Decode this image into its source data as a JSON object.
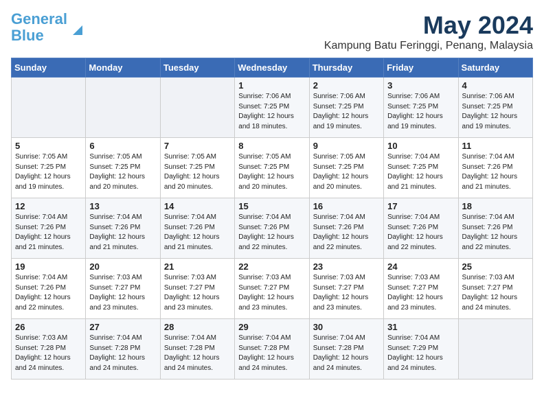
{
  "logo": {
    "line1": "General",
    "line2": "Blue"
  },
  "title": "May 2024",
  "subtitle": "Kampung Batu Feringgi, Penang, Malaysia",
  "weekdays": [
    "Sunday",
    "Monday",
    "Tuesday",
    "Wednesday",
    "Thursday",
    "Friday",
    "Saturday"
  ],
  "weeks": [
    [
      {
        "day": "",
        "info": ""
      },
      {
        "day": "",
        "info": ""
      },
      {
        "day": "",
        "info": ""
      },
      {
        "day": "1",
        "info": "Sunrise: 7:06 AM\nSunset: 7:25 PM\nDaylight: 12 hours\nand 18 minutes."
      },
      {
        "day": "2",
        "info": "Sunrise: 7:06 AM\nSunset: 7:25 PM\nDaylight: 12 hours\nand 19 minutes."
      },
      {
        "day": "3",
        "info": "Sunrise: 7:06 AM\nSunset: 7:25 PM\nDaylight: 12 hours\nand 19 minutes."
      },
      {
        "day": "4",
        "info": "Sunrise: 7:06 AM\nSunset: 7:25 PM\nDaylight: 12 hours\nand 19 minutes."
      }
    ],
    [
      {
        "day": "5",
        "info": "Sunrise: 7:05 AM\nSunset: 7:25 PM\nDaylight: 12 hours\nand 19 minutes."
      },
      {
        "day": "6",
        "info": "Sunrise: 7:05 AM\nSunset: 7:25 PM\nDaylight: 12 hours\nand 20 minutes."
      },
      {
        "day": "7",
        "info": "Sunrise: 7:05 AM\nSunset: 7:25 PM\nDaylight: 12 hours\nand 20 minutes."
      },
      {
        "day": "8",
        "info": "Sunrise: 7:05 AM\nSunset: 7:25 PM\nDaylight: 12 hours\nand 20 minutes."
      },
      {
        "day": "9",
        "info": "Sunrise: 7:05 AM\nSunset: 7:25 PM\nDaylight: 12 hours\nand 20 minutes."
      },
      {
        "day": "10",
        "info": "Sunrise: 7:04 AM\nSunset: 7:25 PM\nDaylight: 12 hours\nand 21 minutes."
      },
      {
        "day": "11",
        "info": "Sunrise: 7:04 AM\nSunset: 7:26 PM\nDaylight: 12 hours\nand 21 minutes."
      }
    ],
    [
      {
        "day": "12",
        "info": "Sunrise: 7:04 AM\nSunset: 7:26 PM\nDaylight: 12 hours\nand 21 minutes."
      },
      {
        "day": "13",
        "info": "Sunrise: 7:04 AM\nSunset: 7:26 PM\nDaylight: 12 hours\nand 21 minutes."
      },
      {
        "day": "14",
        "info": "Sunrise: 7:04 AM\nSunset: 7:26 PM\nDaylight: 12 hours\nand 21 minutes."
      },
      {
        "day": "15",
        "info": "Sunrise: 7:04 AM\nSunset: 7:26 PM\nDaylight: 12 hours\nand 22 minutes."
      },
      {
        "day": "16",
        "info": "Sunrise: 7:04 AM\nSunset: 7:26 PM\nDaylight: 12 hours\nand 22 minutes."
      },
      {
        "day": "17",
        "info": "Sunrise: 7:04 AM\nSunset: 7:26 PM\nDaylight: 12 hours\nand 22 minutes."
      },
      {
        "day": "18",
        "info": "Sunrise: 7:04 AM\nSunset: 7:26 PM\nDaylight: 12 hours\nand 22 minutes."
      }
    ],
    [
      {
        "day": "19",
        "info": "Sunrise: 7:04 AM\nSunset: 7:26 PM\nDaylight: 12 hours\nand 22 minutes."
      },
      {
        "day": "20",
        "info": "Sunrise: 7:03 AM\nSunset: 7:27 PM\nDaylight: 12 hours\nand 23 minutes."
      },
      {
        "day": "21",
        "info": "Sunrise: 7:03 AM\nSunset: 7:27 PM\nDaylight: 12 hours\nand 23 minutes."
      },
      {
        "day": "22",
        "info": "Sunrise: 7:03 AM\nSunset: 7:27 PM\nDaylight: 12 hours\nand 23 minutes."
      },
      {
        "day": "23",
        "info": "Sunrise: 7:03 AM\nSunset: 7:27 PM\nDaylight: 12 hours\nand 23 minutes."
      },
      {
        "day": "24",
        "info": "Sunrise: 7:03 AM\nSunset: 7:27 PM\nDaylight: 12 hours\nand 23 minutes."
      },
      {
        "day": "25",
        "info": "Sunrise: 7:03 AM\nSunset: 7:27 PM\nDaylight: 12 hours\nand 24 minutes."
      }
    ],
    [
      {
        "day": "26",
        "info": "Sunrise: 7:03 AM\nSunset: 7:28 PM\nDaylight: 12 hours\nand 24 minutes."
      },
      {
        "day": "27",
        "info": "Sunrise: 7:04 AM\nSunset: 7:28 PM\nDaylight: 12 hours\nand 24 minutes."
      },
      {
        "day": "28",
        "info": "Sunrise: 7:04 AM\nSunset: 7:28 PM\nDaylight: 12 hours\nand 24 minutes."
      },
      {
        "day": "29",
        "info": "Sunrise: 7:04 AM\nSunset: 7:28 PM\nDaylight: 12 hours\nand 24 minutes."
      },
      {
        "day": "30",
        "info": "Sunrise: 7:04 AM\nSunset: 7:28 PM\nDaylight: 12 hours\nand 24 minutes."
      },
      {
        "day": "31",
        "info": "Sunrise: 7:04 AM\nSunset: 7:29 PM\nDaylight: 12 hours\nand 24 minutes."
      },
      {
        "day": "",
        "info": ""
      }
    ]
  ]
}
